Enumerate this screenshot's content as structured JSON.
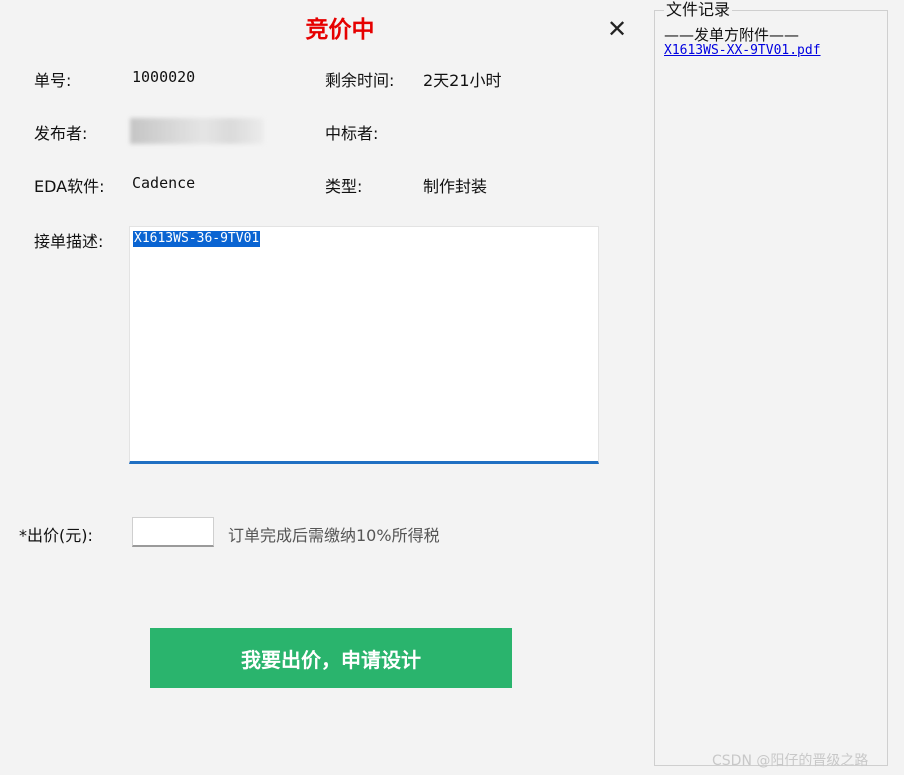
{
  "dialog": {
    "title": "竞价中",
    "close_glyph": "✕"
  },
  "details": {
    "order_no_label": "单号:",
    "order_no_value": "1000020",
    "remaining_label": "剩余时间:",
    "remaining_value": "2天21小时",
    "publisher_label": "发布者:",
    "winner_label": "中标者:",
    "winner_value": "",
    "eda_label": "EDA软件:",
    "eda_value": "Cadence",
    "type_label": "类型:",
    "type_value": "制作封装",
    "desc_label": "接单描述:",
    "desc_value": "X1613WS-36-9TV01"
  },
  "bid": {
    "label": "*出价(元):",
    "value": "",
    "hint": "订单完成后需缴纳10%所得税",
    "button_label": "我要出价，申请设计"
  },
  "files": {
    "title": "文件记录",
    "section": "——发单方附件——",
    "items": [
      "X1613WS-XX-9TV01.pdf"
    ]
  },
  "watermark": "CSDN @阳仔的晋级之路",
  "colors": {
    "title": "#e60000",
    "button": "#2ab46d",
    "selection": "#0a64d2",
    "link": "#0000e0"
  }
}
